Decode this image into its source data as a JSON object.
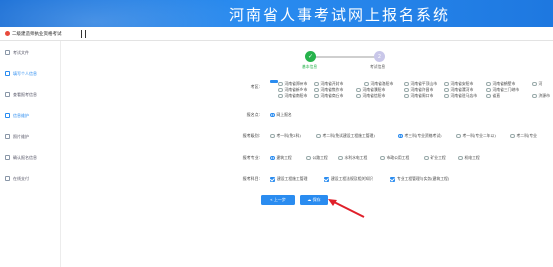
{
  "banner": {
    "title": "河南省人事考试网上报名系统"
  },
  "app": {
    "title": "二级建造师执业资格考试"
  },
  "sidebar": {
    "items": [
      {
        "label": "考试文件"
      },
      {
        "label": "填写个人信息"
      },
      {
        "label": "查看报考信息"
      },
      {
        "label": "信息维护"
      },
      {
        "label": "照片维护"
      },
      {
        "label": "确认报名信息"
      },
      {
        "label": "在线支付"
      }
    ],
    "active_index": 3
  },
  "steps": [
    {
      "label": "基本信息",
      "mark": "✓"
    },
    {
      "label": "考试信息",
      "mark": "2"
    }
  ],
  "form": {
    "region": {
      "label": "考区:",
      "options": [
        "河南省郑州市",
        "河南省开封市",
        "河南省洛阳市",
        "河南省平顶山市",
        "河南省安阳市",
        "河南省鹤壁市",
        "河",
        "河南省新乡市",
        "河南省焦作市",
        "河南省濮阳市",
        "河南省许昌市",
        "河南省漯河市",
        "河南省三门峡市",
        "河南省南阳市",
        "河南省商丘市",
        "河南省信阳市",
        "河南省周口市",
        "河南省驻马店市",
        "省直",
        "济源市"
      ]
    },
    "exam_point": {
      "label": "报名点:",
      "options": [
        "网上报名"
      ],
      "selected": 0
    },
    "category": {
      "label": "报考级别:",
      "options": [
        "考一科(免2科)",
        "考二科(免试建设工程施工管理)",
        "考三科(专业资格考试)",
        "考一科(专业二年以)",
        "考二科(专业"
      ],
      "selected": 2
    },
    "major": {
      "label": "报考专业:",
      "options": [
        "建筑工程",
        "公路工程",
        "水利水电工程",
        "市政公用工程",
        "矿业工程",
        "机电工程"
      ],
      "selected": 0
    },
    "subjects": {
      "label": "报考科目:",
      "options": [
        "建设工程施工管理",
        "建设工程法规及相关知识",
        "专业工程管理与实务(建筑工程)"
      ]
    }
  },
  "buttons": {
    "prev": "« 上一步",
    "save": "☁ 保存"
  },
  "colors": {
    "accent": "#2a8cf0",
    "success": "#26b24b",
    "pending": "#c9c7e9",
    "annotation_arrow": "#e0202a"
  }
}
